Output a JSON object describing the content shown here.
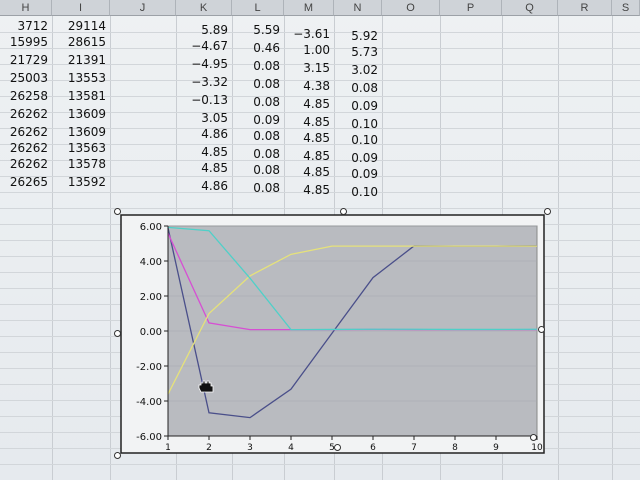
{
  "columns": [
    "H",
    "I",
    "J",
    "K",
    "L",
    "M",
    "N",
    "O",
    "P",
    "Q",
    "R",
    "S"
  ],
  "rows": [
    {
      "H": "3712",
      "I": "29114",
      "K": "5.89",
      "L": "5.59",
      "M": "−3.61",
      "N": "5.92"
    },
    {
      "H": "15995",
      "I": "28615",
      "K": "−4.67",
      "L": "0.46",
      "M": "1.00",
      "N": "5.73"
    },
    {
      "H": "21729",
      "I": "21391",
      "K": "−4.95",
      "L": "0.08",
      "M": "3.15",
      "N": "3.02"
    },
    {
      "H": "25003",
      "I": "13553",
      "K": "−3.32",
      "L": "0.08",
      "M": "4.38",
      "N": "0.08"
    },
    {
      "H": "26258",
      "I": "13581",
      "K": "−0.13",
      "L": "0.08",
      "M": "4.85",
      "N": "0.09"
    },
    {
      "H": "26262",
      "I": "13609",
      "K": "3.05",
      "L": "0.09",
      "M": "4.85",
      "N": "0.10"
    },
    {
      "H": "26262",
      "I": "13609",
      "K": "4.86",
      "L": "0.08",
      "M": "4.85",
      "N": "0.10"
    },
    {
      "H": "26262",
      "I": "13563",
      "K": "4.85",
      "L": "0.08",
      "M": "4.85",
      "N": "0.09"
    },
    {
      "H": "26262",
      "I": "13578",
      "K": "4.85",
      "L": "0.08",
      "M": "4.85",
      "N": "0.09"
    },
    {
      "H": "26265",
      "I": "13592",
      "K": "4.86",
      "L": "0.08",
      "M": "4.85",
      "N": "0.10"
    }
  ],
  "chart_data": {
    "type": "line",
    "title": "",
    "xlabel": "",
    "ylabel": "",
    "x": [
      1,
      2,
      3,
      4,
      5,
      6,
      7,
      8,
      9,
      10
    ],
    "xlim": [
      1,
      10
    ],
    "ylim": [
      -6,
      6
    ],
    "x_ticks": [
      "1",
      "2",
      "3",
      "4",
      "5",
      "6",
      "7",
      "8",
      "9",
      "10"
    ],
    "y_ticks": [
      "6.00",
      "4.00",
      "2.00",
      "0.00",
      "-2.00",
      "-4.00",
      "-6.00"
    ],
    "y_tick_values": [
      6,
      4,
      2,
      0,
      -2,
      -4,
      -6
    ],
    "grid": true,
    "legend": "none",
    "plot_background": "#b9bbc0",
    "series": [
      {
        "color": "#4a4f8a",
        "values": [
          5.89,
          -4.67,
          -4.95,
          -3.32,
          -0.13,
          3.05,
          4.86,
          4.85,
          4.85,
          4.86
        ]
      },
      {
        "color": "#d64fd3",
        "values": [
          5.59,
          0.46,
          0.08,
          0.08,
          0.08,
          0.09,
          0.08,
          0.08,
          0.08,
          0.08
        ]
      },
      {
        "color": "#e6e27a",
        "values": [
          -3.61,
          1.0,
          3.15,
          4.38,
          4.85,
          4.85,
          4.85,
          4.85,
          4.85,
          4.85
        ]
      },
      {
        "color": "#4fd0c8",
        "values": [
          5.92,
          5.73,
          3.02,
          0.08,
          0.09,
          0.1,
          0.1,
          0.09,
          0.09,
          0.1
        ]
      }
    ]
  }
}
